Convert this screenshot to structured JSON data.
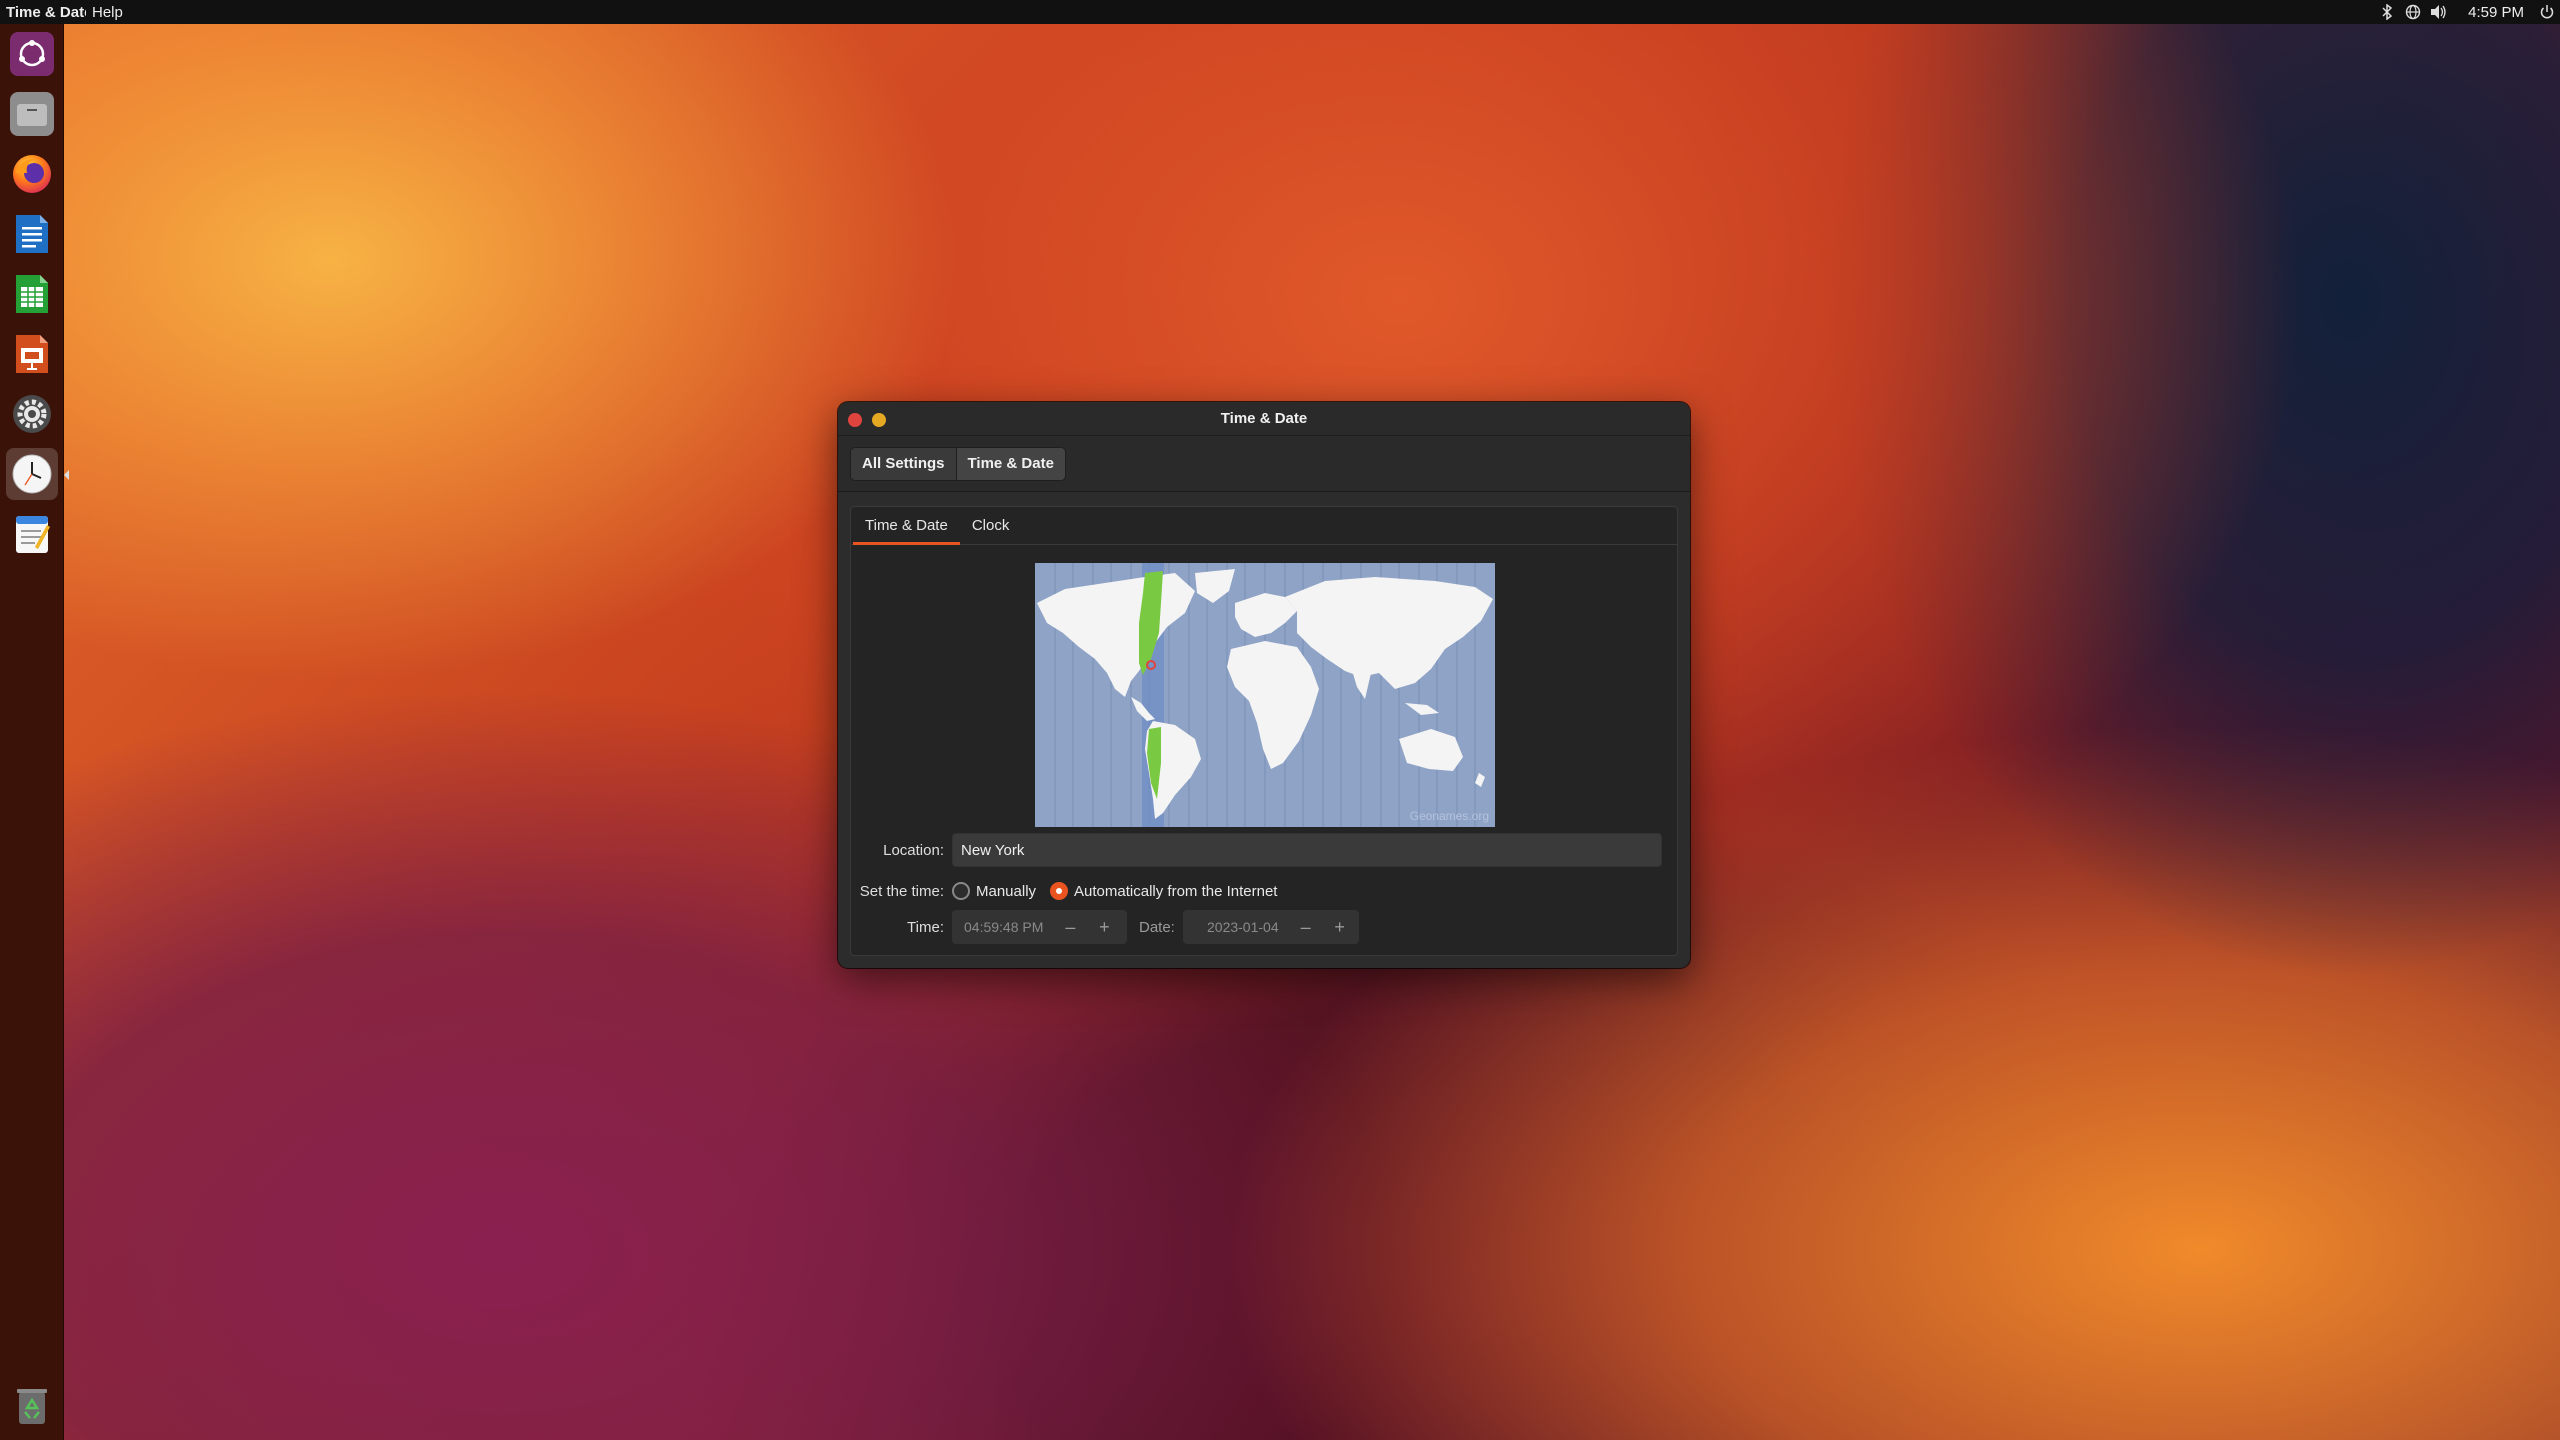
{
  "topbar": {
    "app_name": "Time & Date",
    "menu_help": "Help",
    "clock": "4:59 PM",
    "icons": [
      "bluetooth-icon",
      "network-icon",
      "volume-icon",
      "power-icon"
    ]
  },
  "dock": {
    "items": [
      {
        "name": "ubuntu-software-icon",
        "glyph": "◎",
        "color": "#7a2e7a"
      },
      {
        "name": "files-icon",
        "glyph": "▬",
        "color": "#8a8a8a"
      },
      {
        "name": "firefox-icon",
        "glyph": "●",
        "color": "#ff6a00"
      },
      {
        "name": "libreoffice-writer-icon",
        "glyph": "▤",
        "color": "#2a76c6"
      },
      {
        "name": "libreoffice-calc-icon",
        "glyph": "▦",
        "color": "#2d9a3a"
      },
      {
        "name": "libreoffice-impress-icon",
        "glyph": "▣",
        "color": "#d0551f"
      },
      {
        "name": "settings-icon",
        "glyph": "⚙",
        "color": "#555555"
      },
      {
        "name": "clock-icon",
        "glyph": "◷",
        "color": "#f2f2f2"
      },
      {
        "name": "text-editor-icon",
        "glyph": "✎",
        "color": "#f4f4f4"
      }
    ],
    "trash": {
      "name": "trash-icon",
      "glyph": "♻",
      "color": "#5a5a5a"
    }
  },
  "window": {
    "title": "Time & Date",
    "breadcrumbs": [
      "All Settings",
      "Time & Date"
    ],
    "tabs": [
      "Time & Date",
      "Clock"
    ],
    "active_tab": "Time & Date",
    "map_credit": "Geonames.org",
    "location": {
      "label": "Location:",
      "value": "New York"
    },
    "set_time": {
      "label": "Set the time:",
      "options": [
        "Manually",
        "Automatically from the Internet"
      ],
      "selected": "Automatically from the Internet"
    },
    "time": {
      "label": "Time:",
      "value": "04:59:48 PM"
    },
    "date": {
      "label": "Date:",
      "value": "2023-01-04"
    },
    "spin_minus": "–",
    "spin_plus": "+"
  },
  "colors": {
    "accent": "#e95420",
    "map_ocean": "#8fa3c7",
    "map_highlight": "#7ac943"
  }
}
